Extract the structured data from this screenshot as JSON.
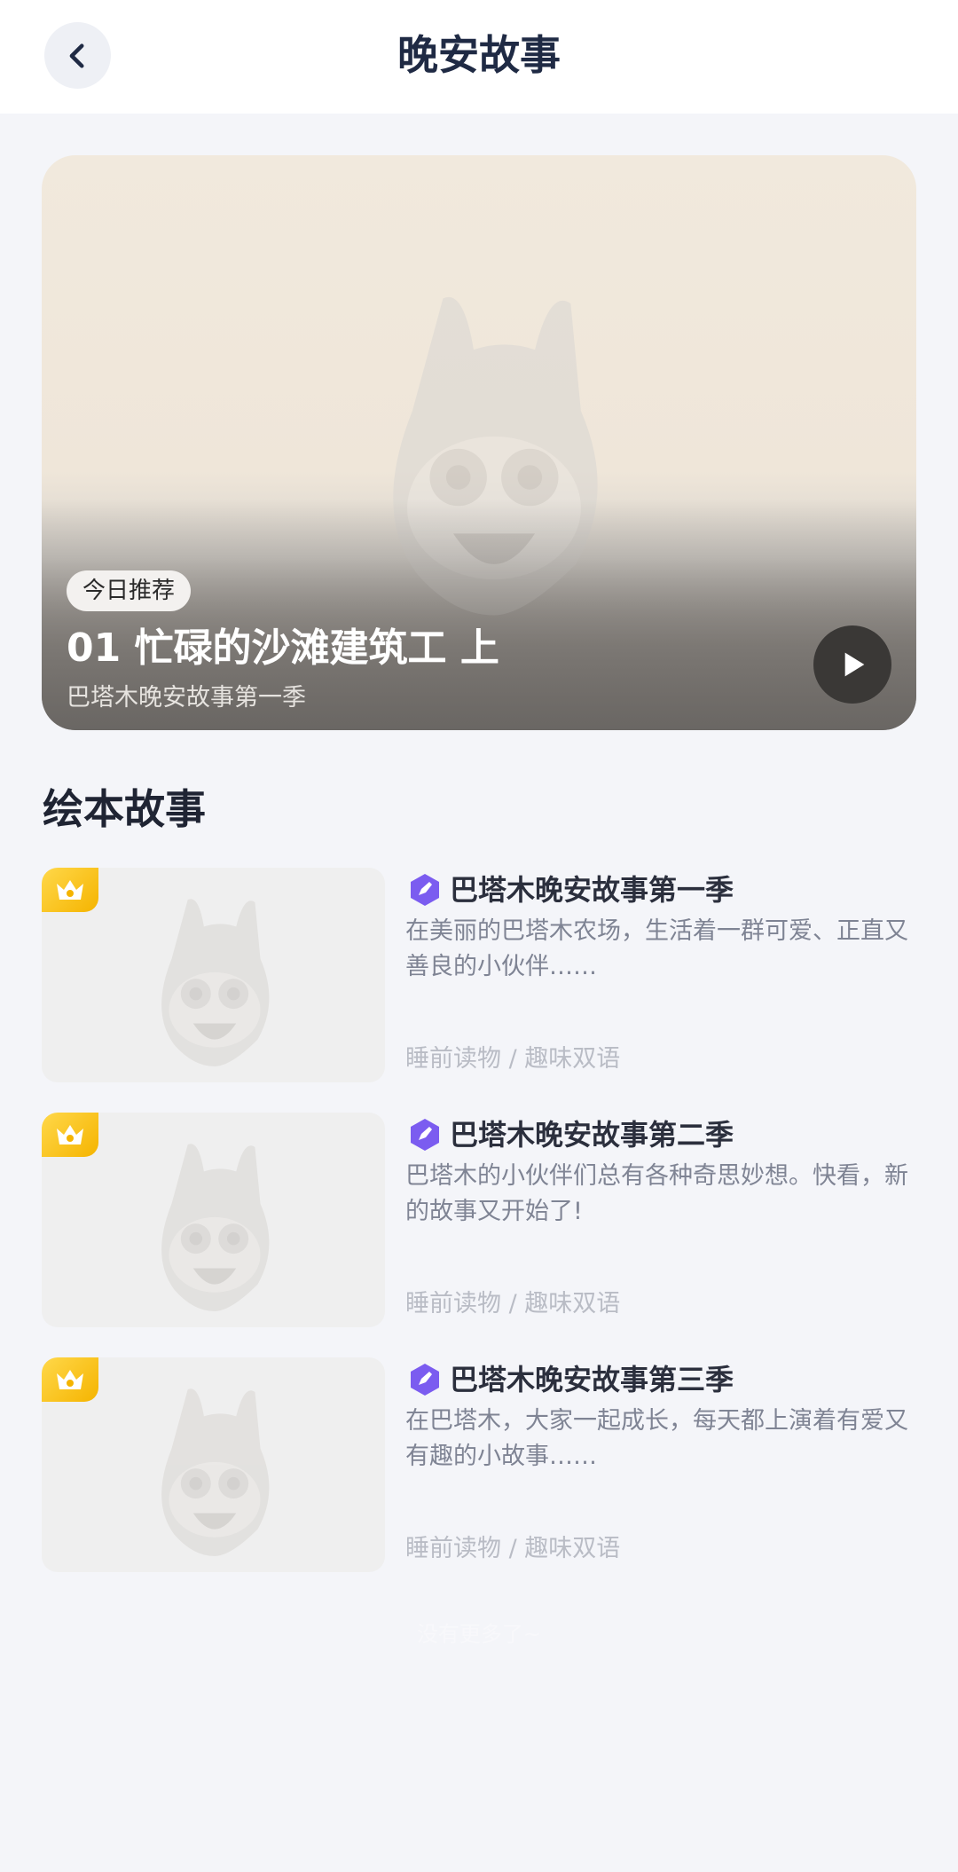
{
  "header": {
    "title": "晚安故事",
    "back_icon": "chevron-left-icon"
  },
  "hero": {
    "badge": "今日推荐",
    "title": "01 忙碌的沙滩建筑工 上",
    "subtitle": "巴塔木晚安故事第一季",
    "play_icon": "play-icon"
  },
  "section": {
    "title": "绘本故事"
  },
  "books": [
    {
      "title": "巴塔木晚安故事第一季",
      "description": "在美丽的巴塔木农场，生活着一群可爱、正直又善良的小伙伴……",
      "tags": "睡前读物 / 趣味双语",
      "badge_icon": "crown-icon"
    },
    {
      "title": "巴塔木晚安故事第二季",
      "description": "巴塔木的小伙伴们总有各种奇思妙想。快看，新的故事又开始了!",
      "tags": "睡前读物 / 趣味双语",
      "badge_icon": "crown-icon"
    },
    {
      "title": "巴塔木晚安故事第三季",
      "description": "在巴塔木，大家一起成长，每天都上演着有爱又有趣的小故事……",
      "tags": "睡前读物 / 趣味双语",
      "badge_icon": "crown-icon"
    }
  ],
  "footer": {
    "note": "没有更多了~"
  },
  "colors": {
    "background": "#f4f5f9",
    "crown": "#f5b400",
    "series_icon": "#7b5cf0"
  }
}
